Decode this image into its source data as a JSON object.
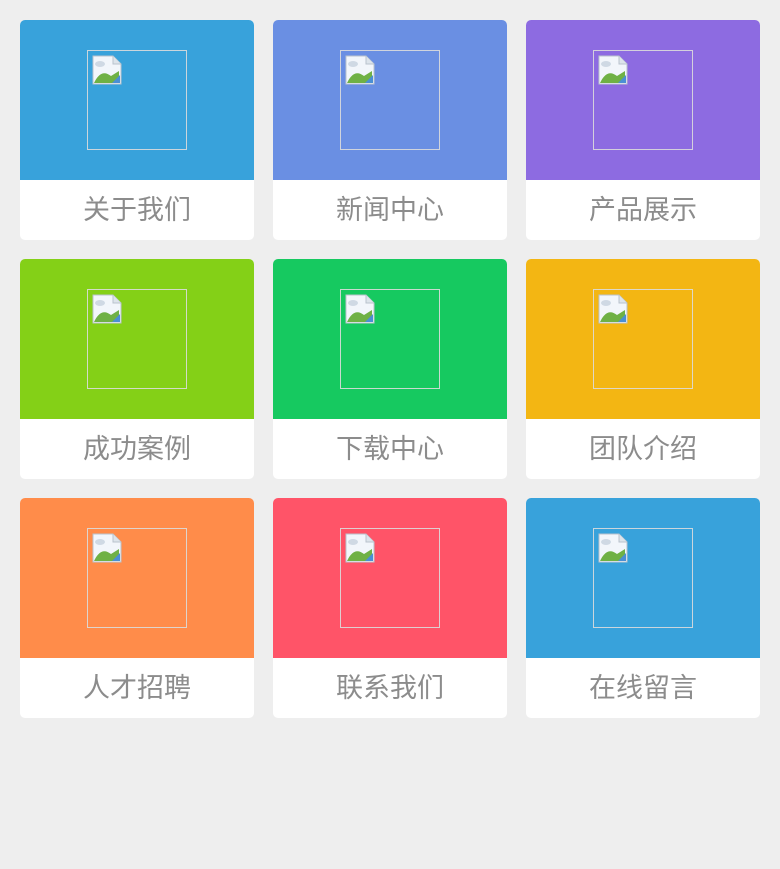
{
  "tiles": [
    {
      "label": "关于我们",
      "color": "#38a2db",
      "icon": "image-placeholder-icon",
      "name": "tile-about-us"
    },
    {
      "label": "新闻中心",
      "color": "#6a8fe3",
      "icon": "image-placeholder-icon",
      "name": "tile-news-center"
    },
    {
      "label": "产品展示",
      "color": "#8d6be1",
      "icon": "image-placeholder-icon",
      "name": "tile-products"
    },
    {
      "label": "成功案例",
      "color": "#84d017",
      "icon": "image-placeholder-icon",
      "name": "tile-success-cases"
    },
    {
      "label": "下载中心",
      "color": "#16c960",
      "icon": "image-placeholder-icon",
      "name": "tile-download-center"
    },
    {
      "label": "团队介绍",
      "color": "#f3b613",
      "icon": "image-placeholder-icon",
      "name": "tile-team"
    },
    {
      "label": "人才招聘",
      "color": "#ff8c4a",
      "icon": "image-placeholder-icon",
      "name": "tile-recruitment"
    },
    {
      "label": "联系我们",
      "color": "#ff5468",
      "icon": "image-placeholder-icon",
      "name": "tile-contact-us"
    },
    {
      "label": "在线留言",
      "color": "#38a2db",
      "icon": "image-placeholder-icon",
      "name": "tile-online-message"
    }
  ]
}
